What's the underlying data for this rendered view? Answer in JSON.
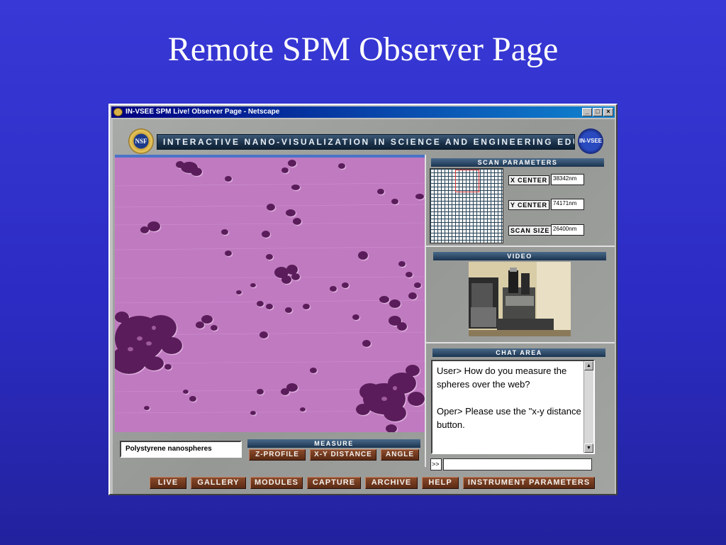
{
  "slide": {
    "title": "Remote SPM Observer Page"
  },
  "window": {
    "title": "IN-VSEE SPM Live! Observer Page - Netscape",
    "controls": {
      "minimize": "_",
      "maximize": "□",
      "close": "×"
    }
  },
  "banner": {
    "text": "INTERACTIVE NANO-VISUALIZATION IN SCIENCE AND ENGINEERING EDUCATION",
    "left_logo": "NSF",
    "right_logo": "IN-VSEE"
  },
  "image": {
    "caption": "Polystyrene nanospheres"
  },
  "measure": {
    "title": "MEASURE",
    "buttons": [
      "Z-PROFILE",
      "X-Y DISTANCE",
      "ANGLE"
    ]
  },
  "scan_parameters": {
    "title": "SCAN PARAMETERS",
    "x_center_label": "X CENTER",
    "x_center_value": "38342nm",
    "y_center_label": "Y CENTER",
    "y_center_value": "74171nm",
    "scan_size_label": "SCAN SIZE",
    "scan_size_value": "26400nm"
  },
  "video": {
    "title": "VIDEO"
  },
  "chat": {
    "title": "CHAT AREA",
    "messages": "User>  How do you measure the spheres over the web?\n\nOper>  Please use the \"x-y distance button.",
    "prompt": ">>",
    "input_value": ""
  },
  "nav": {
    "buttons": [
      "LIVE",
      "GALLERY",
      "MODULES",
      "CAPTURE",
      "ARCHIVE",
      "HELP",
      "INSTRUMENT PARAMETERS"
    ]
  },
  "colors": {
    "slide_background": "#3030cc",
    "afm_image": "#c07ac0",
    "button": "#6a341a"
  }
}
